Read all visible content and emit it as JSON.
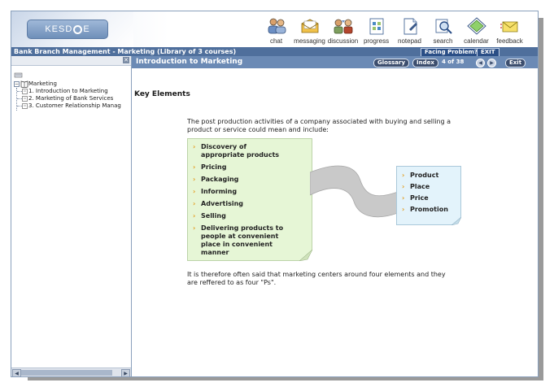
{
  "logo_text": "KESDEE",
  "toolbar": [
    {
      "label": "chat",
      "icon": "chat-icon"
    },
    {
      "label": "messaging",
      "icon": "messaging-icon"
    },
    {
      "label": "discussion",
      "icon": "discussion-icon"
    },
    {
      "label": "progress",
      "icon": "progress-icon"
    },
    {
      "label": "notepad",
      "icon": "notepad-icon"
    },
    {
      "label": "search",
      "icon": "search-icon"
    },
    {
      "label": "calendar",
      "icon": "calendar-icon"
    },
    {
      "label": "feedback",
      "icon": "feedback-icon"
    }
  ],
  "course_bar": {
    "title": "Bank Branch Management - Marketing (Library of 3 courses)",
    "facing_problem": "Facing Problem?",
    "exit": "EXIT"
  },
  "tree": {
    "root": "Marketing",
    "items": [
      "1. Introduction to Marketing",
      "2. Marketing of Bank Services",
      "3. Customer Relationship Manag"
    ]
  },
  "content": {
    "title": "Introduction to Marketing",
    "glossary": "Glossary",
    "index": "Index",
    "page_indicator": "4 of 38",
    "exit": "Exit",
    "heading": "Key Elements",
    "intro_line1": "The post production activities of a company associated with buying and selling a",
    "intro_line2": "product or service could mean and include:",
    "left_list": [
      [
        "Discovery of",
        "appropriate products"
      ],
      [
        "Pricing"
      ],
      [
        "Packaging"
      ],
      [
        "Informing"
      ],
      [
        "Advertising"
      ],
      [
        "Selling"
      ],
      [
        "Delivering products to",
        "people at convenient",
        "place in convenient",
        "manner"
      ]
    ],
    "right_list": [
      "Product",
      "Place",
      "Price",
      "Promotion"
    ],
    "conclusion_line1": "It is therefore often said that marketing centers around four elements and they",
    "conclusion_line2": "are reffered to as four \"Ps\"."
  },
  "colors": {
    "course_bar": "#4f6f9c",
    "title_bar": "#6b8ab5",
    "bullet": "#e39b1a",
    "left_note": "#e6f6d6",
    "right_note": "#e3f3fb"
  }
}
